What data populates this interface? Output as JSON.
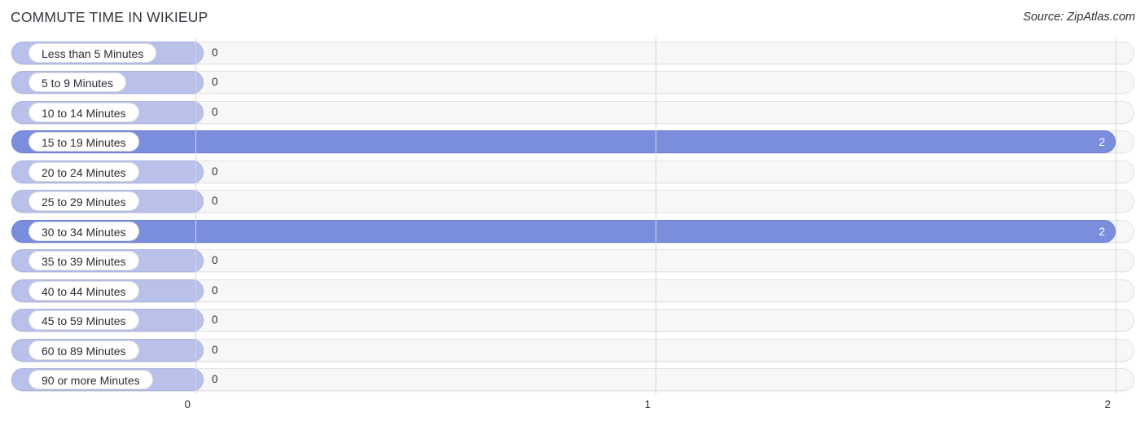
{
  "header": {
    "title": "COMMUTE TIME IN WIKIEUP",
    "source": "Source: ZipAtlas.com"
  },
  "colors": {
    "bar_filled": "#7b8ede",
    "bar_zero": "#b9c1ea",
    "track": "#f7f7f7",
    "gridline": "#d6d6d6",
    "label_text": "#2e2e36"
  },
  "chart_data": {
    "type": "bar",
    "orientation": "horizontal",
    "title": "COMMUTE TIME IN WIKIEUP",
    "xlabel": "",
    "ylabel": "",
    "xlim": [
      0,
      2
    ],
    "grid": true,
    "legend": "none",
    "xticks": [
      "0",
      "1",
      "2"
    ],
    "xtick_values": [
      0,
      1,
      2
    ],
    "categories": [
      "Less than 5 Minutes",
      "5 to 9 Minutes",
      "10 to 14 Minutes",
      "15 to 19 Minutes",
      "20 to 24 Minutes",
      "25 to 29 Minutes",
      "30 to 34 Minutes",
      "35 to 39 Minutes",
      "40 to 44 Minutes",
      "45 to 59 Minutes",
      "60 to 89 Minutes",
      "90 or more Minutes"
    ],
    "values": [
      0,
      0,
      0,
      2,
      0,
      0,
      2,
      0,
      0,
      0,
      0,
      0
    ],
    "value_labels": [
      "0",
      "0",
      "0",
      "2",
      "0",
      "0",
      "2",
      "0",
      "0",
      "0",
      "0",
      "0"
    ]
  },
  "rows": [
    {
      "label": "Less than 5 Minutes",
      "value": 0,
      "value_label": "0"
    },
    {
      "label": "5 to 9 Minutes",
      "value": 0,
      "value_label": "0"
    },
    {
      "label": "10 to 14 Minutes",
      "value": 0,
      "value_label": "0"
    },
    {
      "label": "15 to 19 Minutes",
      "value": 2,
      "value_label": "2"
    },
    {
      "label": "20 to 24 Minutes",
      "value": 0,
      "value_label": "0"
    },
    {
      "label": "25 to 29 Minutes",
      "value": 0,
      "value_label": "0"
    },
    {
      "label": "30 to 34 Minutes",
      "value": 2,
      "value_label": "2"
    },
    {
      "label": "35 to 39 Minutes",
      "value": 0,
      "value_label": "0"
    },
    {
      "label": "40 to 44 Minutes",
      "value": 0,
      "value_label": "0"
    },
    {
      "label": "45 to 59 Minutes",
      "value": 0,
      "value_label": "0"
    },
    {
      "label": "60 to 89 Minutes",
      "value": 0,
      "value_label": "0"
    },
    {
      "label": "90 or more Minutes",
      "value": 0,
      "value_label": "0"
    }
  ],
  "axis": {
    "ticks": [
      {
        "label": "0",
        "value": 0
      },
      {
        "label": "1",
        "value": 1
      },
      {
        "label": "2",
        "value": 2
      }
    ]
  }
}
